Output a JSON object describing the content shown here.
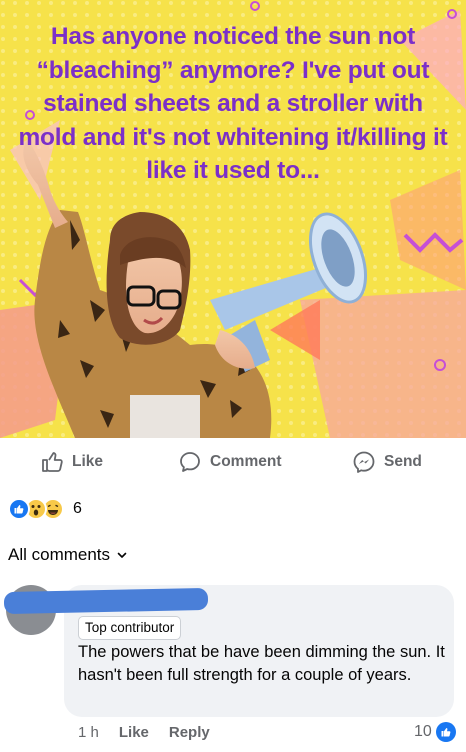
{
  "post": {
    "image_text": "Has anyone noticed the sun not “bleaching” anymore? I've put out stained sheets and a stroller with mold and it's not whitening it/killing it like it used to..."
  },
  "actions": {
    "like_label": "Like",
    "comment_label": "Comment",
    "send_label": "Send"
  },
  "reactions": {
    "count": "6",
    "icons": [
      "like-reaction-icon",
      "wow-reaction-icon",
      "haha-reaction-icon"
    ]
  },
  "comments_filter": {
    "label": "All comments"
  },
  "comment": {
    "badge": "Top contributor",
    "text": "The powers that be have been dimming the sun. It hasn't been full strength for a couple of years.",
    "time": "1 h",
    "like_label": "Like",
    "reply_label": "Reply",
    "like_count": "10"
  },
  "colors": {
    "post_text": "#7b2fc9",
    "image_background": "#f6e24a",
    "facebook_blue": "#1877f2",
    "redaction": "#4a7fd8",
    "comment_bubble": "#f0f2f5"
  }
}
